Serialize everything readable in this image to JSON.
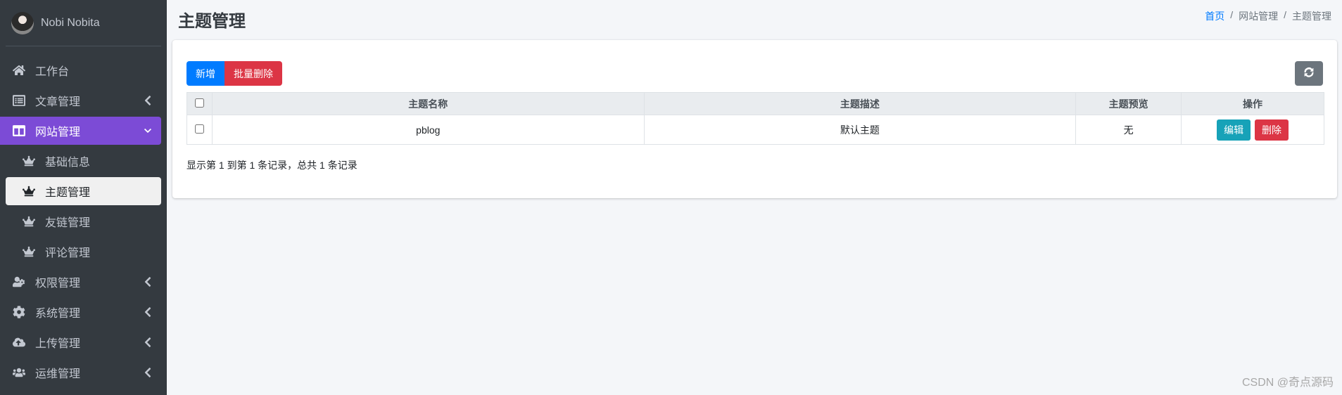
{
  "user": {
    "name": "Nobi Nobita"
  },
  "sidebar": {
    "items": [
      {
        "label": "工作台",
        "icon": "home-icon"
      },
      {
        "label": "文章管理",
        "icon": "table-icon",
        "has_children": true
      },
      {
        "label": "网站管理",
        "icon": "layout-icon",
        "expanded": true,
        "children": [
          {
            "label": "基础信息",
            "icon": "crown-icon"
          },
          {
            "label": "主题管理",
            "icon": "crown-icon",
            "active": true
          },
          {
            "label": "友链管理",
            "icon": "crown-icon"
          },
          {
            "label": "评论管理",
            "icon": "crown-icon"
          }
        ]
      },
      {
        "label": "权限管理",
        "icon": "user-cog-icon",
        "has_children": true
      },
      {
        "label": "系统管理",
        "icon": "gear-icon",
        "has_children": true
      },
      {
        "label": "上传管理",
        "icon": "cloud-upload-icon",
        "has_children": true
      },
      {
        "label": "运维管理",
        "icon": "users-icon",
        "has_children": true
      }
    ]
  },
  "page": {
    "title": "主题管理",
    "breadcrumb": [
      "首页",
      "/",
      "网站管理",
      "/",
      "主题管理"
    ]
  },
  "toolbar": {
    "add_label": "新增",
    "batch_delete_label": "批量删除",
    "refresh_icon": "refresh-icon"
  },
  "table": {
    "columns": [
      "",
      "主题名称",
      "主题描述",
      "主题预览",
      "操作"
    ],
    "rows": [
      {
        "name": "pblog",
        "description": "默认主题",
        "preview": "无",
        "edit_label": "编辑",
        "delete_label": "删除"
      }
    ]
  },
  "pagination": {
    "info": "显示第 1 到第 1 条记录，总共 1 条记录"
  },
  "watermark": "CSDN @奇点源码",
  "colors": {
    "sidebar_bg": "#343a40",
    "active_parent": "#7c4bd6",
    "primary": "#007bff",
    "danger": "#dc3545",
    "info": "#17a2b8",
    "secondary": "#6c757d"
  }
}
